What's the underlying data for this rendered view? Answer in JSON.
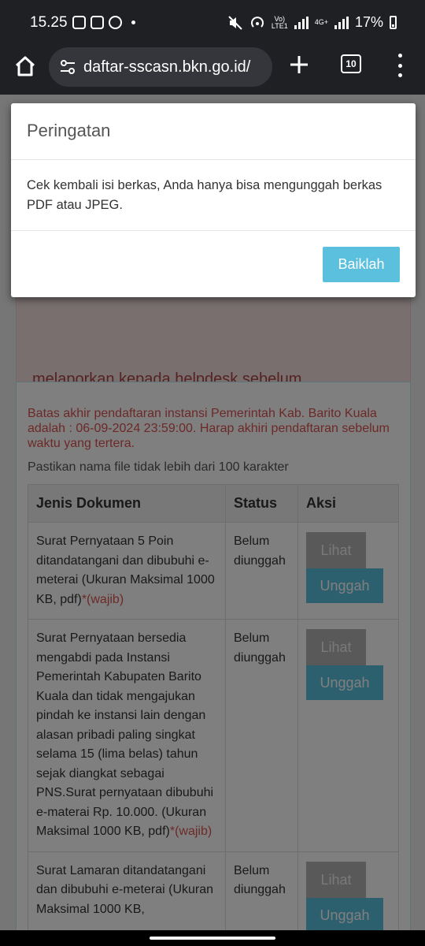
{
  "status_bar": {
    "time": "15.25",
    "volte": "Vo)",
    "lte": "LTE1",
    "net4g": "4G+",
    "battery": "17%"
  },
  "browser": {
    "url": "daftar-sscasn.bkn.go.id/",
    "tab_count": "10"
  },
  "page": {
    "alert_text": "melaporkan kepada helpdesk sebelum melanjutkan.",
    "deadline_text": "Batas akhir pendaftaran instansi Pemerintah Kab. Barito Kuala adalah : 06-09-2024 23:59:00. Harap akhiri pendaftaran sebelum waktu yang tertera.",
    "filename_note": "Pastikan nama file tidak lebih dari 100 karakter",
    "table": {
      "headers": [
        "Jenis Dokumen",
        "Status",
        "Aksi"
      ],
      "rows": [
        {
          "doc": "Surat Pernyataan 5 Poin ditandatangani dan dibubuhi e-meterai (Ukuran Maksimal 1000 KB, pdf)",
          "required": "*(wajib)",
          "status": "Belum diunggah",
          "view_label": "Lihat",
          "upload_label": "Unggah"
        },
        {
          "doc": "Surat Pernyataan bersedia mengabdi pada Instansi Pemerintah Kabupaten Barito Kuala dan tidak mengajukan pindah ke instansi lain dengan alasan pribadi paling singkat selama 15 (lima belas) tahun sejak diangkat sebagai PNS.Surat pernyataan dibubuhi e-materai Rp. 10.000. (Ukuran Maksimal 1000 KB, pdf)",
          "required": "*(wajib)",
          "status": "Belum diunggah",
          "view_label": "Lihat",
          "upload_label": "Unggah"
        },
        {
          "doc": "Surat Lamaran ditandatangani dan dibubuhi e-meterai (Ukuran Maksimal 1000 KB,",
          "required": "",
          "status": "Belum diunggah",
          "view_label": "Lihat",
          "upload_label": "Unggah"
        }
      ]
    }
  },
  "modal": {
    "title": "Peringatan",
    "message": "Cek kembali isi berkas, Anda hanya bisa mengunggah berkas PDF atau JPEG.",
    "ok_label": "Baiklah"
  }
}
